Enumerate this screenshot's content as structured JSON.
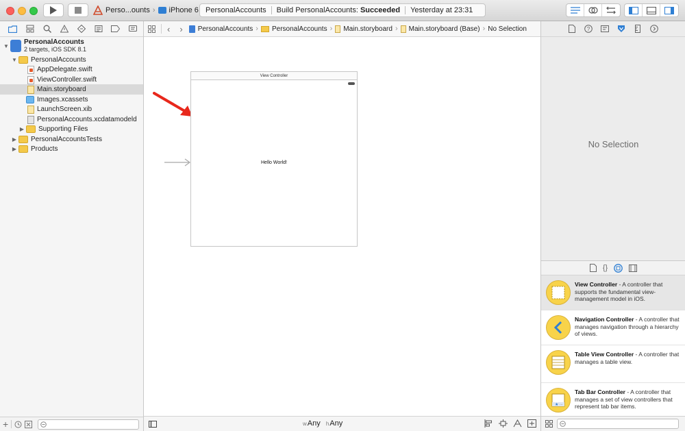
{
  "toolbar": {
    "scheme": "Perso...ounts",
    "device": "iPhone 6",
    "activity_project": "PersonalAccounts",
    "activity_status_prefix": "Build PersonalAccounts:",
    "activity_status_result": "Succeeded",
    "activity_time": "Yesterday at 23:31"
  },
  "navigator": {
    "project": {
      "name": "PersonalAccounts",
      "subtitle": "2 targets, iOS SDK 8.1"
    },
    "items": [
      {
        "label": "PersonalAccounts",
        "kind": "group"
      },
      {
        "label": "AppDelegate.swift",
        "kind": "swift"
      },
      {
        "label": "ViewController.swift",
        "kind": "swift"
      },
      {
        "label": "Main.storyboard",
        "kind": "storyboard"
      },
      {
        "label": "Images.xcassets",
        "kind": "assets"
      },
      {
        "label": "LaunchScreen.xib",
        "kind": "xib"
      },
      {
        "label": "PersonalAccounts.xcdatamodeld",
        "kind": "model"
      },
      {
        "label": "Supporting Files",
        "kind": "group"
      },
      {
        "label": "PersonalAccountsTests",
        "kind": "group"
      },
      {
        "label": "Products",
        "kind": "group"
      }
    ]
  },
  "jumpbar": {
    "crumbs": [
      "PersonalAccounts",
      "PersonalAccounts",
      "Main.storyboard",
      "Main.storyboard (Base)",
      "No Selection"
    ]
  },
  "canvas": {
    "scene_title": "View Controller",
    "label_text": "Hello World!"
  },
  "editor_footer": {
    "width_prefix": "w",
    "width_value": "Any",
    "height_prefix": "h",
    "height_value": "Any"
  },
  "inspector": {
    "no_selection": "No Selection"
  },
  "library": {
    "items": [
      {
        "title": "View Controller",
        "desc": " - A controller that supports the fundamental view-management model in iOS."
      },
      {
        "title": "Navigation Controller",
        "desc": " - A controller that manages navigation through a hierarchy of views."
      },
      {
        "title": "Table View Controller",
        "desc": " - A controller that manages a table view."
      },
      {
        "title": "Tab Bar Controller",
        "desc": " - A controller that manages a set of view controllers that represent tab bar items."
      }
    ]
  },
  "colors": {
    "accent": "#2f7fd3",
    "selection": "#d9d9d9",
    "folder": "#f4c94a",
    "library_icon": "#f8d34a",
    "annotation_arrow": "#e8281c"
  }
}
